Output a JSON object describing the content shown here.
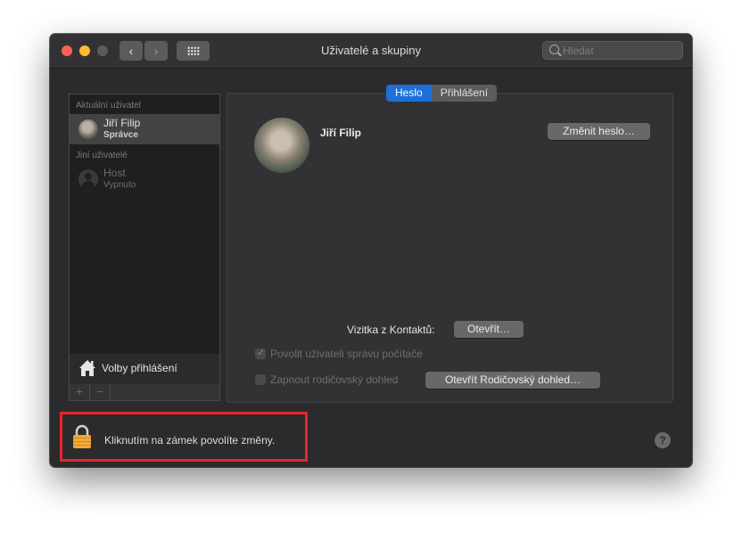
{
  "window": {
    "title": "Uživatelé a skupiny",
    "search_placeholder": "Hledat",
    "nav": {
      "back_glyph": "‹",
      "forward_glyph": "›"
    }
  },
  "sidebar": {
    "current_header": "Aktuální uživatel",
    "current_user": {
      "name": "Jiří Filip",
      "role": "Správce"
    },
    "other_header": "Jiní uživatelé",
    "other_users": [
      {
        "name": "Host",
        "status": "Vypnuto"
      }
    ],
    "login_options_label": "Volby přihlášení",
    "add_glyph": "+",
    "remove_glyph": "−"
  },
  "panel": {
    "tabs": [
      {
        "label": "Heslo",
        "active": true
      },
      {
        "label": "Přihlášení",
        "active": false
      }
    ],
    "user_name": "Jiří Filip",
    "change_password_label": "Změnit heslo…",
    "contact_card_label": "Vizitka z Kontaktů:",
    "open_label": "Otevřít…",
    "allow_admin_label": "Povolit uživateli správu počítače",
    "allow_admin_checked": true,
    "parental_label": "Zapnout rodičovský dohled",
    "parental_checked": false,
    "open_parental_label": "Otevřít Rodičovský dohled…"
  },
  "footer": {
    "lock_text": "Kliknutím na zámek povolíte změny.",
    "help_glyph": "?"
  },
  "colors": {
    "accent": "#1d6fd9",
    "highlight": "#e8242c",
    "lock": "#f0a93a"
  }
}
